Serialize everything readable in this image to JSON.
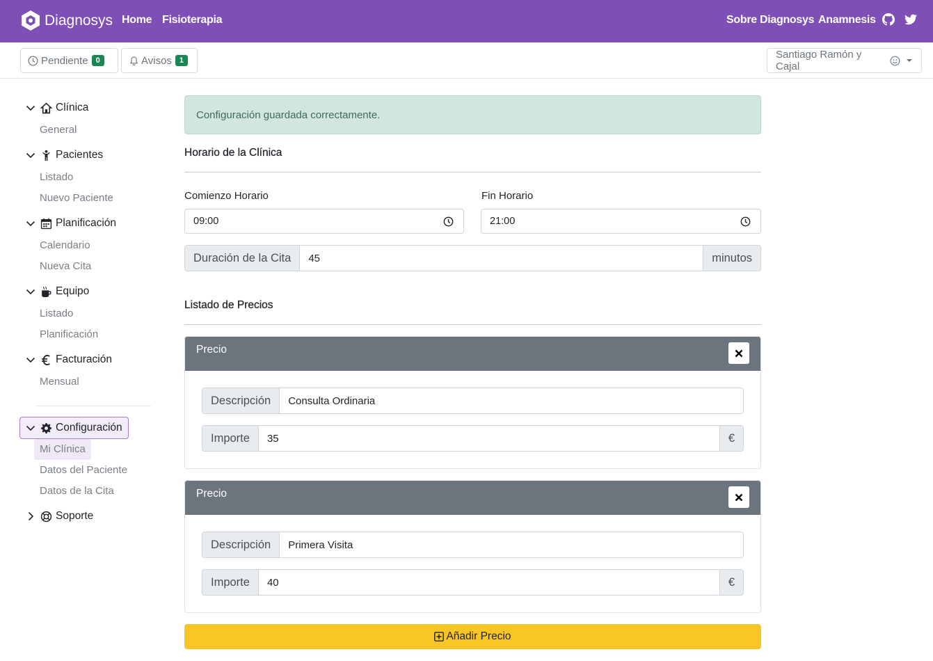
{
  "navbar": {
    "brand": "Diagnosys",
    "links": [
      "Home",
      "Fisioterapia"
    ],
    "right_links": [
      "Sobre Diagnosys",
      "Anamnesis"
    ],
    "icons": [
      "github-icon",
      "twitter-icon"
    ]
  },
  "toolbar": {
    "pending_label": "Pendiente",
    "pending_count": "0",
    "alerts_label": "Avisos",
    "alerts_count": "1",
    "user_name": "Santiago Ramón y Cajal"
  },
  "sidebar": {
    "sections": [
      {
        "label": "Clínica",
        "icon": "home-icon",
        "items": [
          "General"
        ]
      },
      {
        "label": "Pacientes",
        "icon": "person-icon",
        "items": [
          "Listado",
          "Nuevo Paciente"
        ]
      },
      {
        "label": "Planificación",
        "icon": "calendar-icon",
        "items": [
          "Calendario",
          "Nueva Cita"
        ]
      },
      {
        "label": "Equipo",
        "icon": "cup-icon",
        "items": [
          "Listado",
          "Planificación"
        ]
      },
      {
        "label": "Facturación",
        "icon": "euro-icon",
        "items": [
          "Mensual"
        ]
      },
      {
        "label": "Configuración",
        "icon": "gear-icon",
        "items": [
          "Mi Clínica",
          "Datos del Paciente",
          "Datos de la Cita"
        ]
      },
      {
        "label": "Soporte",
        "icon": "lifebuoy-icon",
        "items": []
      }
    ]
  },
  "alert": {
    "text": "Configuración guardada correctamente."
  },
  "schedule": {
    "title": "Horario de la Clínica",
    "start_label": "Comienzo Horario",
    "start_value": "09:00",
    "end_label": "Fin Horario",
    "end_value": "21:00",
    "duration_label": "Duración de la Cita",
    "duration_value": "45",
    "duration_unit": "minutos"
  },
  "prices": {
    "title": "Listado de Precios",
    "cards": [
      {
        "header": "Precio",
        "desc_label": "Descripción",
        "desc_value": "Consulta Ordinaria",
        "amount_label": "Importe",
        "amount_value": "35",
        "currency": "€"
      },
      {
        "header": "Precio",
        "desc_label": "Descripción",
        "desc_value": "Primera Visita",
        "amount_label": "Importe",
        "amount_value": "40",
        "currency": "€"
      }
    ],
    "add_label": "Añadir Precio"
  },
  "colors": {
    "navbar": "#7e4fb5",
    "alert_bg": "#d1e7dd",
    "card_header": "#6c757d",
    "add_button": "#f7c524",
    "badge": "#198754"
  }
}
